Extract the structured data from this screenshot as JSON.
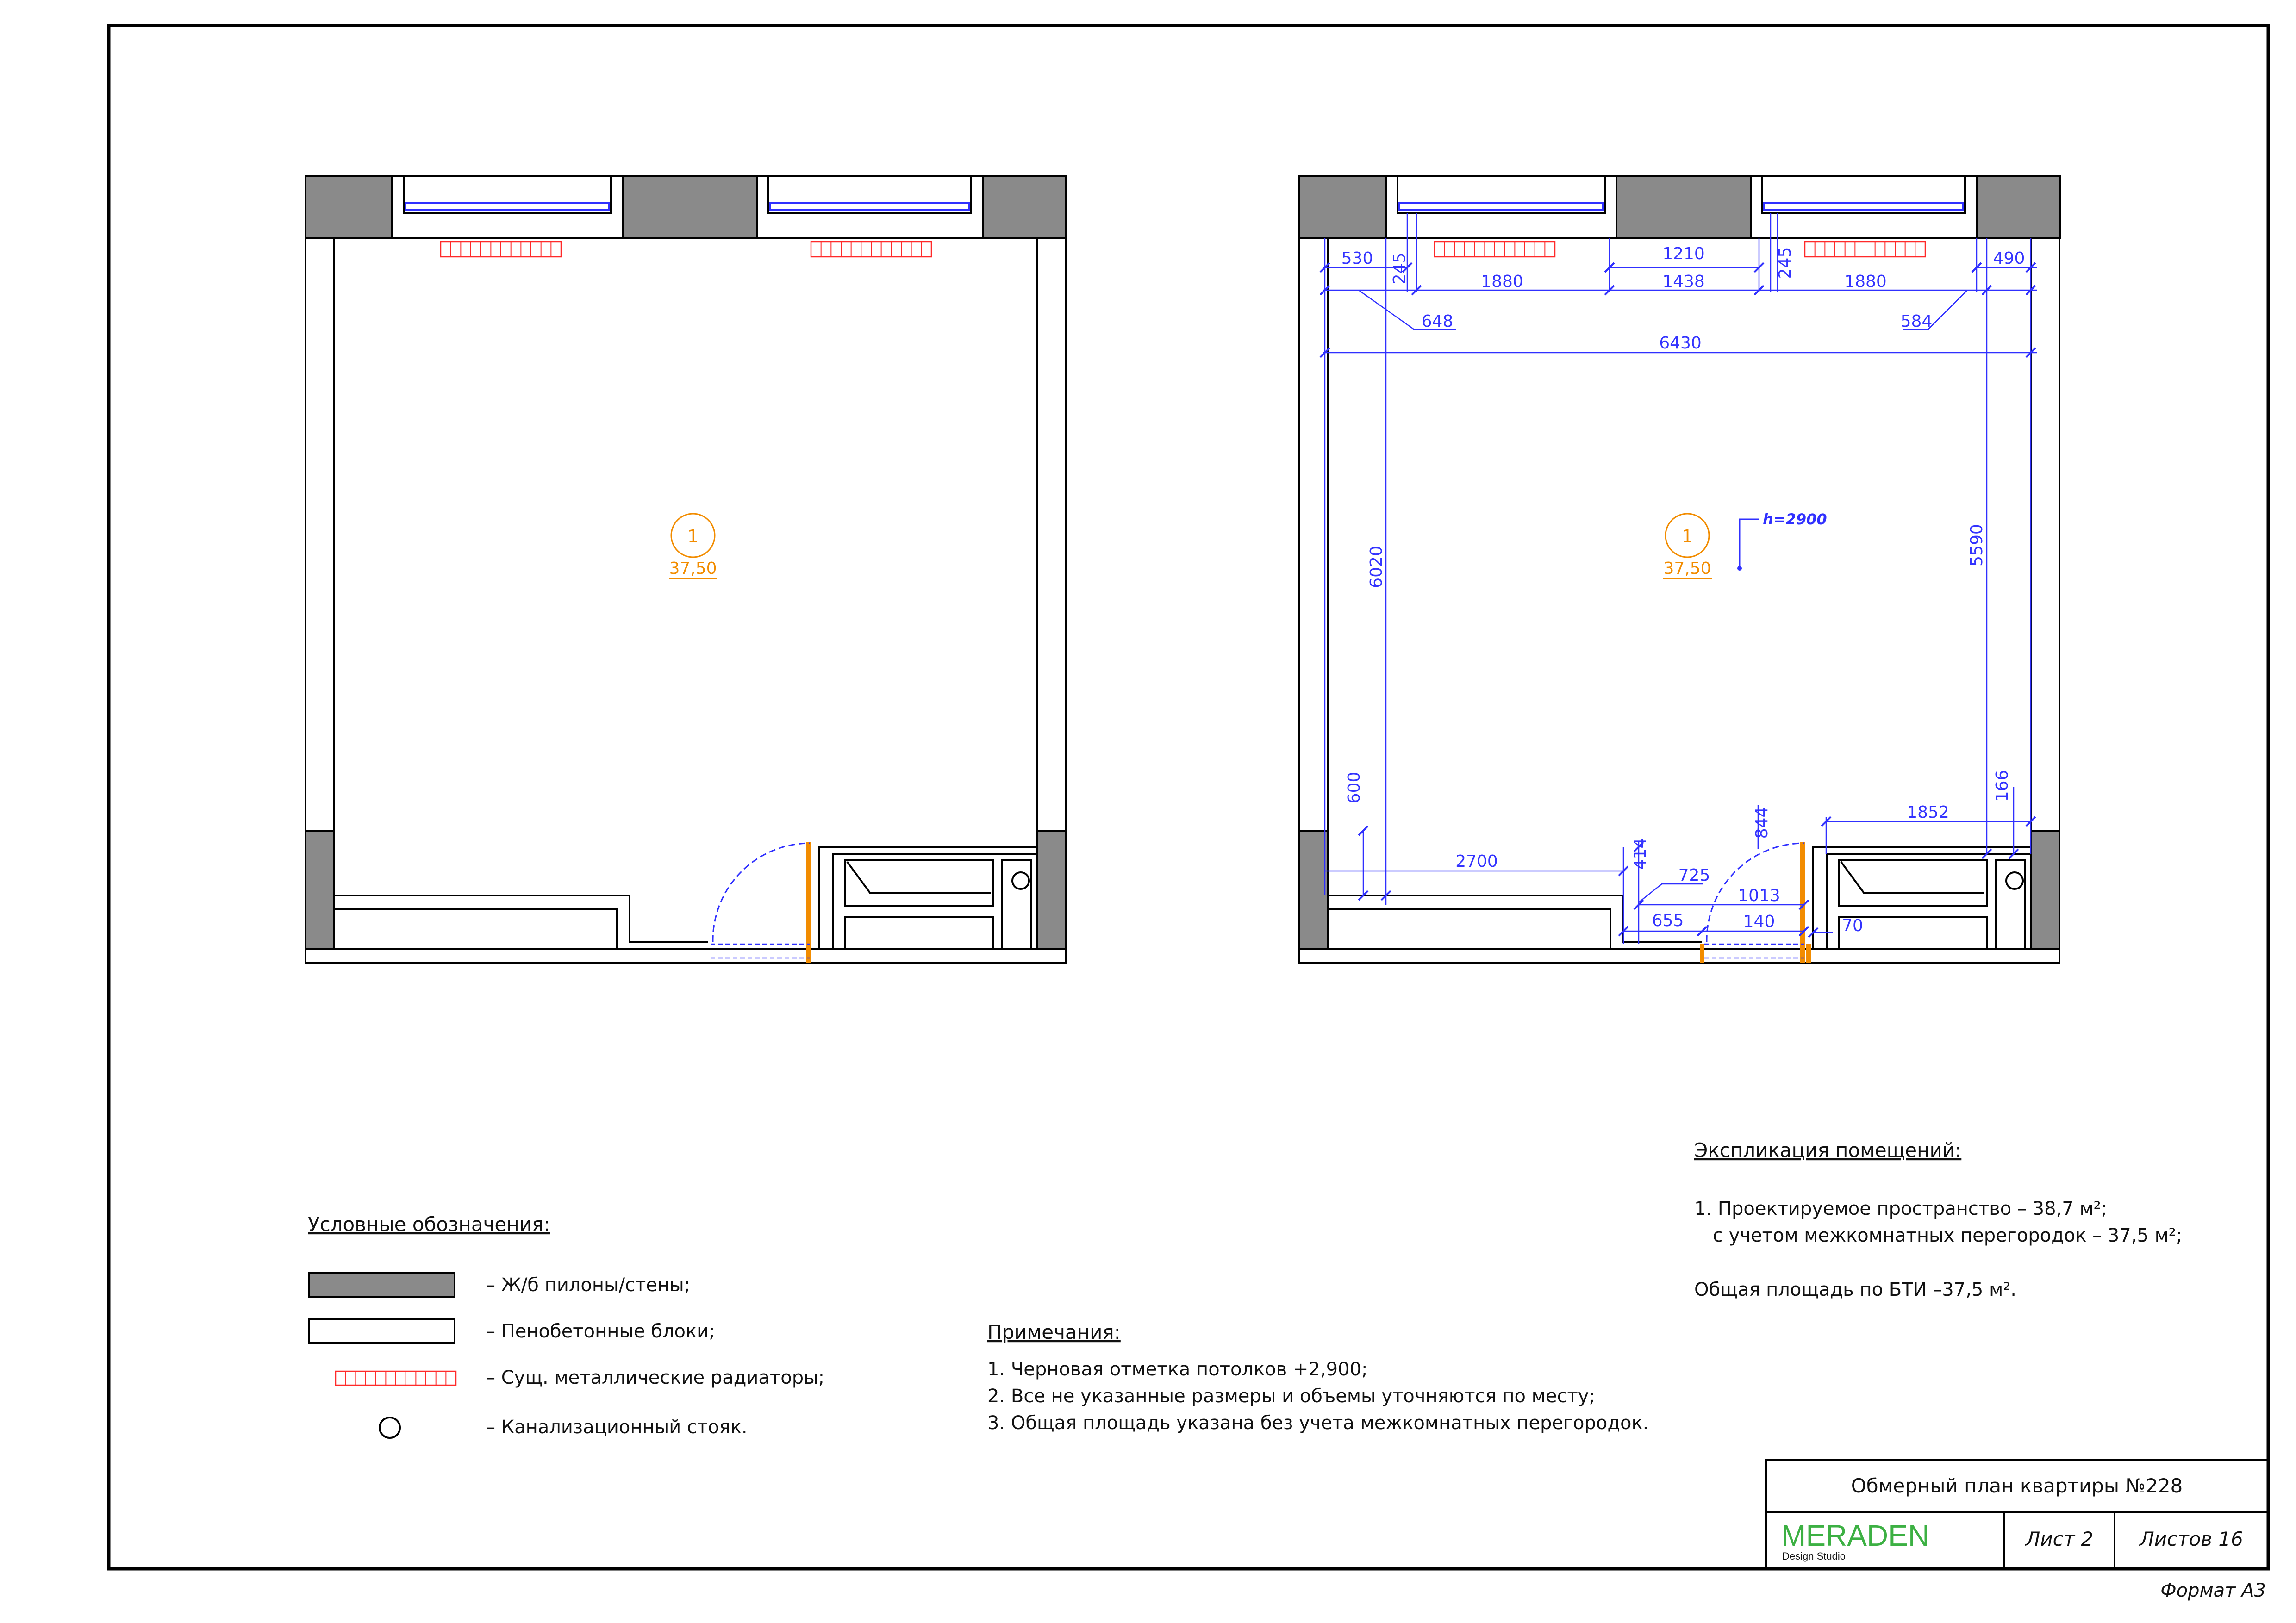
{
  "plan": {
    "room_number": "1",
    "room_area": "37,50",
    "ceiling_height_label": "h=2900",
    "dimensions": {
      "top_left_pier": "530",
      "window_depth_left": "245",
      "window_left": "1880",
      "middle_pier_outer": "1210",
      "middle_pier_inner": "1438",
      "window_depth_right": "245",
      "window_right": "1880",
      "top_right_pier": "490",
      "left_offset": "648",
      "right_offset": "584",
      "overall_width": "6430",
      "left_height": "6020",
      "right_height": "5590",
      "left_bottom_pier": "600",
      "bottom_left_wall": "2700",
      "niche_depth": "414",
      "diag_725": "725",
      "niche_655": "655",
      "door_844": "844",
      "door_1013": "1013",
      "door_140": "140",
      "wall_70": "70",
      "right_block_width": "1852",
      "right_block_166": "166"
    }
  },
  "legend": {
    "title": "Условные обозначения:",
    "items": [
      {
        "label": "– Ж/б пилоны/стены;",
        "symbol": "concrete"
      },
      {
        "label": "– Пенобетонные блоки;",
        "symbol": "foam-block"
      },
      {
        "label": "– Сущ. металлические радиаторы;",
        "symbol": "radiator"
      },
      {
        "label": "– Канализационный стояк.",
        "symbol": "sewer-riser"
      }
    ]
  },
  "notes": {
    "title": "Примечания:",
    "lines": [
      "1. Черновая отметка потолков +2,900;",
      "2. Все не указанные размеры и объемы уточняются по месту;",
      "3. Общая площадь указана без учета межкомнатных перегородок."
    ]
  },
  "explication": {
    "title": "Экспликация помещений:",
    "line1": "1. Проектируемое пространство – 38,7 м²;",
    "line2": "с учетом межкомнатных перегородок – 37,5 м²;",
    "line3": "Общая площадь по БТИ –37,5 м²."
  },
  "title_block": {
    "drawing_title": "Обмерный план квартиры №228",
    "brand": "MERADEN",
    "brand_sub": "Design Studio",
    "sheet": "Лист 2",
    "sheets_total": "Листов 16",
    "format": "Формат  А3"
  },
  "colors": {
    "concrete": "#8a8a8a",
    "dimension": "#3030ff",
    "radiator": "#ff2a2a",
    "room_tag": "#f28c00",
    "brand": "#3cb043"
  }
}
